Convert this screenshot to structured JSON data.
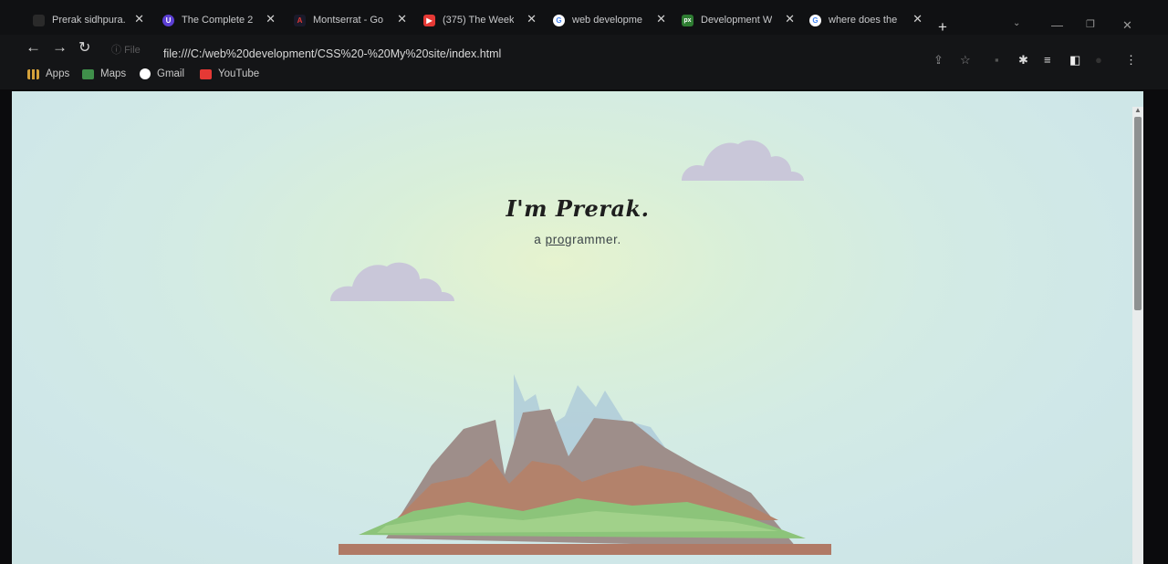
{
  "tabs": [
    {
      "label": "Prerak sidhpura.",
      "icon": "user-favicon-icon",
      "color": "#2a2a2a"
    },
    {
      "label": "The Complete 2",
      "icon": "udemy-favicon-icon",
      "color": "#5c3fd4"
    },
    {
      "label": "Montserrat - Go",
      "icon": "google-fonts-favicon-icon",
      "color": "#c62828"
    },
    {
      "label": "(375) The Week",
      "icon": "youtube-favicon-icon",
      "color": "#e53935"
    },
    {
      "label": "web developme",
      "icon": "google-favicon-icon",
      "color": "#ffffff"
    },
    {
      "label": "Development W",
      "icon": "px-favicon-icon",
      "color": "#2e7d32"
    },
    {
      "label": "where does the",
      "icon": "google-favicon-icon",
      "color": "#ffffff"
    }
  ],
  "toolbar": {
    "info_label": "File",
    "url": "file:///C:/web%20development/CSS%20-%20My%20site/index.html"
  },
  "bookmarks": [
    {
      "label": "Apps",
      "icon": "apps-grid-icon",
      "color": "#d4a13a"
    },
    {
      "label": "Maps",
      "icon": "maps-icon",
      "color": "#3f8f4a"
    },
    {
      "label": "Gmail",
      "icon": "google-icon",
      "color": "#ffffff"
    },
    {
      "label": "YouTube",
      "icon": "youtube-icon",
      "color": "#e53935"
    }
  ],
  "page": {
    "title": "I'm Prerak.",
    "subtitle_prefix": "a ",
    "subtitle_link": "pro",
    "subtitle_rest": "grammer."
  },
  "colors": {
    "cloud": "#c9c7d9",
    "mountain_dark": "#9e8e8a",
    "mountain_clay": "#b3826b",
    "grass": "#8cc47a",
    "ground": "#b07a66",
    "sky_accent": "#a9c7d8"
  }
}
